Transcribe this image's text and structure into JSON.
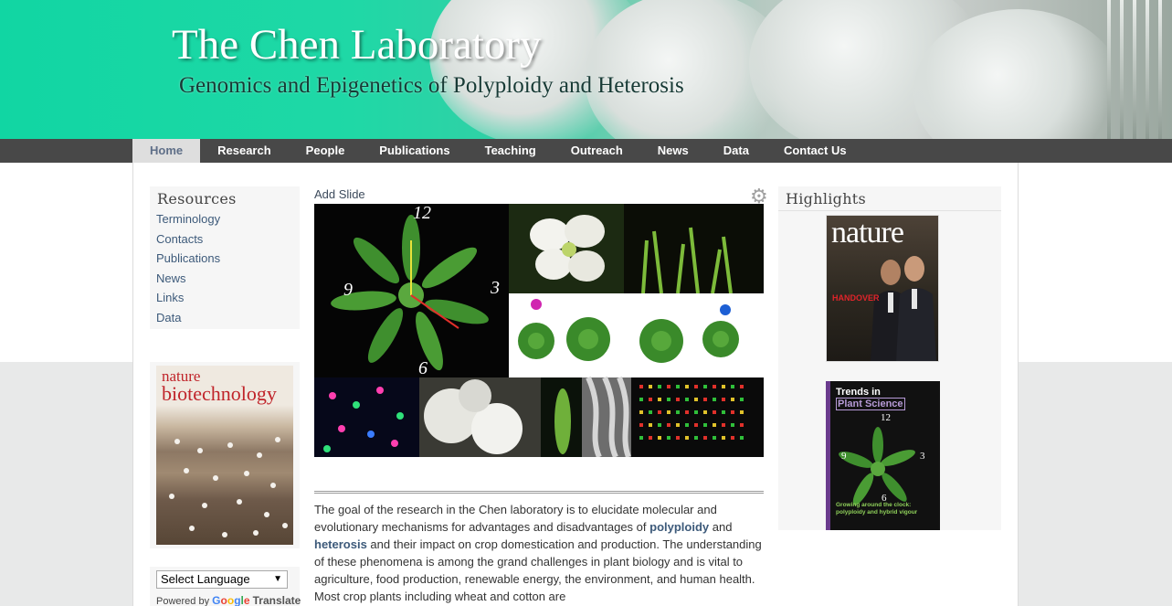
{
  "header": {
    "title": "The Chen Laboratory",
    "subtitle": "Genomics and Epigenetics of Polyploidy and Heterosis"
  },
  "nav": {
    "items": [
      "Home",
      "Research",
      "People",
      "Publications",
      "Teaching",
      "Outreach",
      "News",
      "Data",
      "Contact Us"
    ],
    "active": "Home"
  },
  "sidebar": {
    "resources_title": "Resources",
    "links": [
      "Terminology",
      "Contacts",
      "Publications",
      "News",
      "Links",
      "Data"
    ],
    "cover": {
      "line1": "nature",
      "line2": "biotechnology"
    },
    "translate": {
      "select_label": "Select Language",
      "powered_by": "Powered by",
      "google": "Google",
      "translate": "Translate"
    }
  },
  "slideshow": {
    "add_slide": "Add Slide",
    "settings_icon": "gear-icon",
    "clock_numbers": [
      "12",
      "3",
      "6",
      "9"
    ]
  },
  "intro": {
    "text_a": "The goal of the research in the Chen laboratory is to elucidate molecular and evolutionary mechanisms for advantages and disadvantages of ",
    "term1": "polyploidy",
    "text_b": " and ",
    "term2": "heterosis",
    "text_c": " and their impact on crop domestication and production. The understanding of these phenomena is among the grand challenges in plant biology and is vital to agriculture, food production, renewable energy, the environment, and human health. Most crop plants including wheat and cotton are"
  },
  "highlights": {
    "title": "Highlights",
    "nature_cover": {
      "logo": "nature",
      "headline": "HANDOVER"
    },
    "trends_cover": {
      "line1": "Trends in",
      "line2": "Plant Science",
      "caption": "Growing around the clock: polyploidy and hybrid vigour",
      "clock_numbers": [
        "12",
        "3",
        "6",
        "9"
      ]
    }
  },
  "colors": {
    "banner_teal": "#11d6a3",
    "nav_bg": "#484848",
    "nav_active_bg": "#dedede",
    "link": "#3d5a7a",
    "sidebar_bg": "#f6f6f6"
  }
}
